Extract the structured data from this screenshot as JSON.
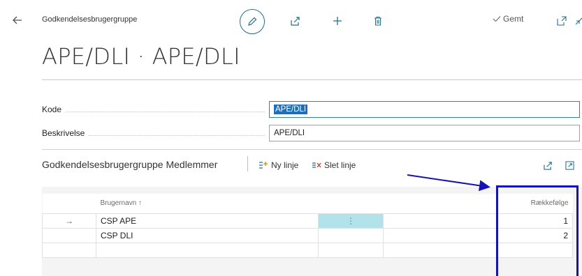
{
  "header": {
    "breadcrumb": "Godkendelsesbrugergruppe",
    "saved_label": "Gemt",
    "title": "APE/DLI · APE/DLI"
  },
  "fields": [
    {
      "label": "Kode",
      "value": "APE/DLI"
    },
    {
      "label": "Beskrivelse",
      "value": "APE/DLI"
    }
  ],
  "subpage": {
    "title": "Godkendelsesbrugergruppe Medlemmer",
    "new_line": "Ny linje",
    "delete_line": "Slet linje"
  },
  "table": {
    "col_user": "Brugernavn ↑",
    "col_order": "Rækkefølge",
    "rows": [
      {
        "indicator": "→",
        "user": "CSP APE",
        "order": "1"
      },
      {
        "indicator": "",
        "user": "CSP DLI",
        "order": "2"
      },
      {
        "indicator": "",
        "user": "",
        "order": ""
      }
    ]
  },
  "colors": {
    "accent": "#1f6f8b",
    "selection": "#1e6ebe",
    "annotation": "#1414b4",
    "active_cell": "#b2e3ea"
  }
}
